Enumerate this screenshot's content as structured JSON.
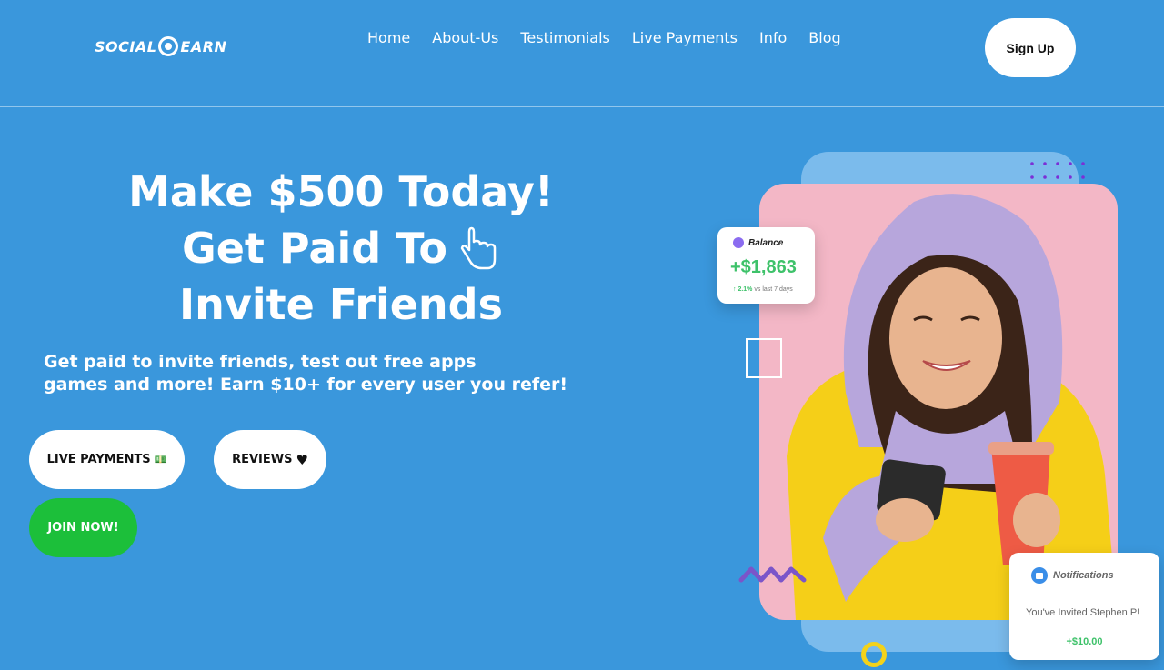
{
  "header": {
    "logo_left": "SOCIAL",
    "logo_right": "EARN",
    "nav": [
      "Home",
      "About-Us",
      "Testimonials",
      "Live Payments",
      "Info",
      "Blog"
    ],
    "signup_label": "Sign Up"
  },
  "hero": {
    "headline_1": "Make $500 Today!",
    "headline_2": "Get Paid To",
    "headline_3": "Invite Friends",
    "subtext_1": "Get paid to invite friends, test out free apps",
    "subtext_2": "games and more! Earn $10+ for every user you refer!",
    "btn_live": "LIVE PAYMENTS",
    "btn_live_icon": "💵",
    "btn_reviews": "REVIEWS",
    "btn_reviews_icon": "♥",
    "btn_join": "JOIN NOW!"
  },
  "balance_card": {
    "title": "Balance",
    "amount": "+$1,863",
    "change_arrow": "↑",
    "change_pct": "2.1%",
    "change_note": "vs last 7 days"
  },
  "notification_card": {
    "title": "Notifications",
    "message": "You've Invited Stephen P!",
    "amount": "+$10.00"
  },
  "colors": {
    "background": "#3a97dc",
    "join_green": "#1cbf3a",
    "photo_pink": "#f3b7c6",
    "positive_green": "#3ec26a"
  }
}
